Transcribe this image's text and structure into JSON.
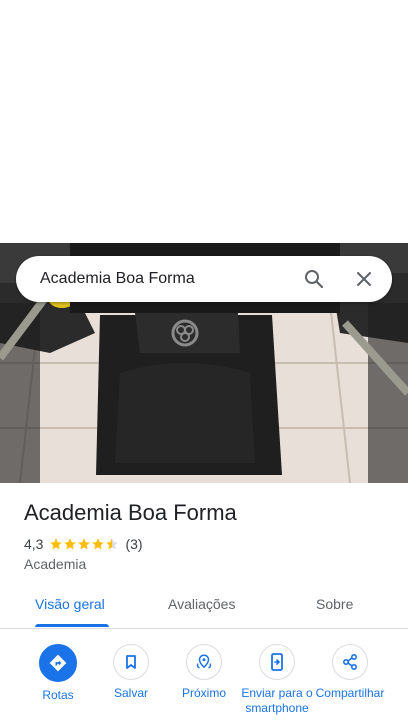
{
  "search": {
    "query": "Academia Boa Forma"
  },
  "place": {
    "name": "Academia Boa Forma",
    "rating": "4,3",
    "rating_value": 4.3,
    "review_count": "(3)",
    "category": "Academia"
  },
  "tabs": [
    {
      "label": "Visão geral",
      "active": true
    },
    {
      "label": "Avaliações",
      "active": false
    },
    {
      "label": "Sobre",
      "active": false
    }
  ],
  "actions": [
    {
      "label": "Rotas",
      "icon": "directions-icon"
    },
    {
      "label": "Salvar",
      "icon": "bookmark-icon"
    },
    {
      "label": "Próximo",
      "icon": "nearby-icon"
    },
    {
      "label": "Enviar para o smartphone",
      "icon": "send-to-phone-icon"
    },
    {
      "label": "Compartilhar",
      "icon": "share-icon"
    }
  ],
  "colors": {
    "accent": "#1a73e8",
    "star": "#fbbc04"
  }
}
